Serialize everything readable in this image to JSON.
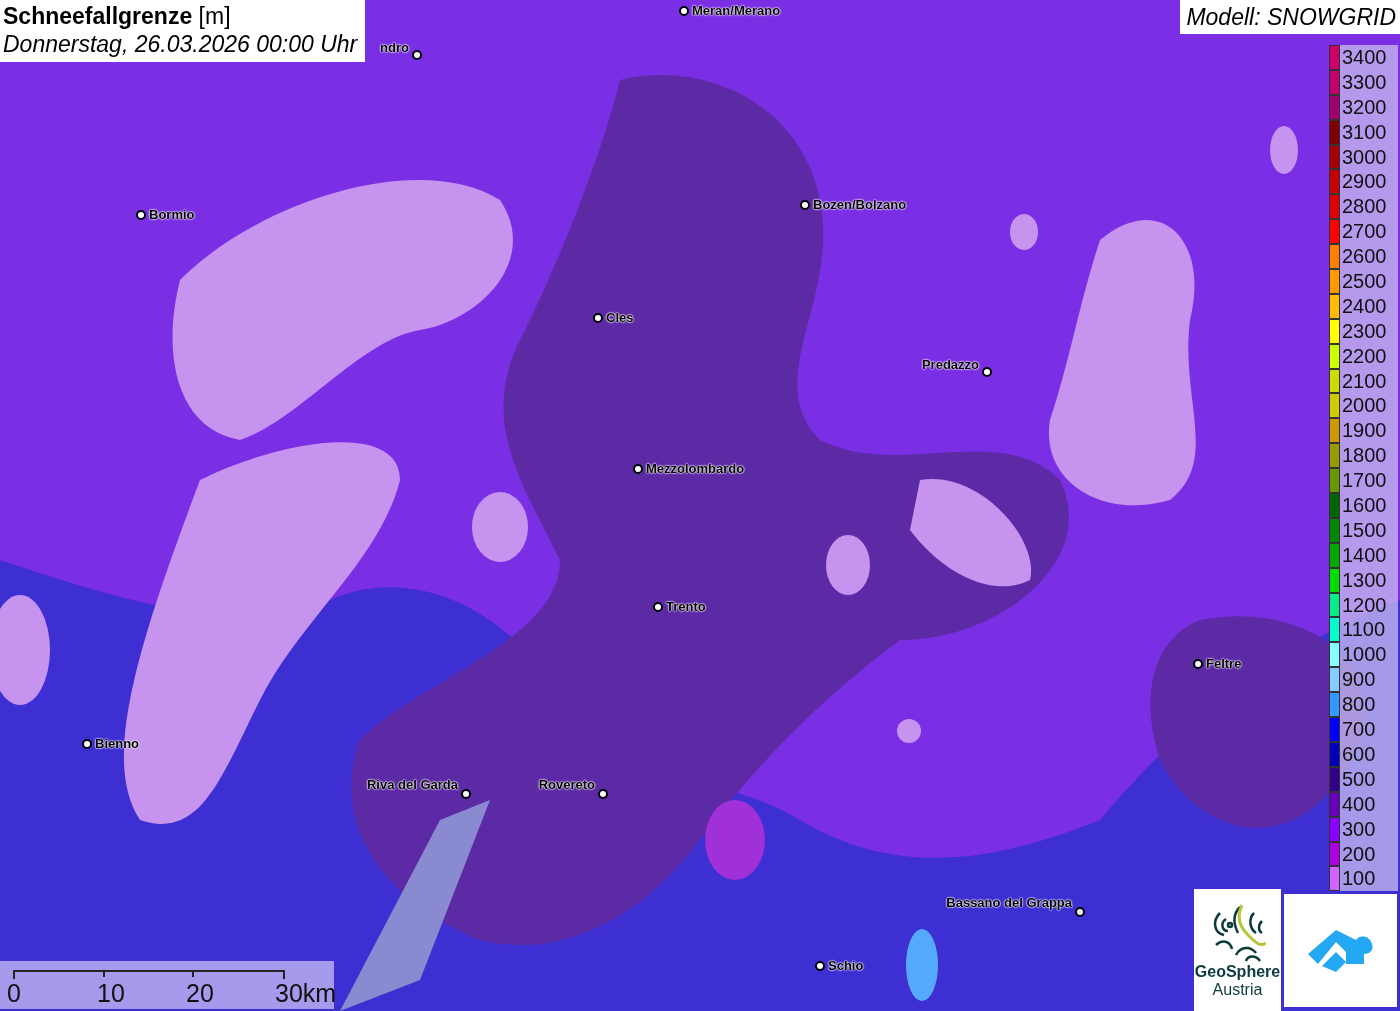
{
  "title": {
    "heading": "**Schneefallgrenze** [m]",
    "date": "Donnerstag, 26.03.2026 00:00 Uhr"
  },
  "model": "Modell: SNOWGRID",
  "places": [
    "Meran/Merano",
    "ndro",
    "Bormio",
    "Bozen/Bolzano",
    "Cles",
    "Predazzo",
    "Mezzolombardo",
    "Trento",
    "Feltre",
    "Bienno",
    "Riva del Garda",
    "Rovereto",
    "Bassano del Grappa",
    "Schio"
  ],
  "legend": [
    {
      "label": "3400",
      "color": "#cc0066"
    },
    {
      "label": "3300",
      "color": "#c2006b"
    },
    {
      "label": "3200",
      "color": "#a0006e"
    },
    {
      "label": "3100",
      "color": "#800000"
    },
    {
      "label": "3000",
      "color": "#a80000"
    },
    {
      "label": "2900",
      "color": "#c80000"
    },
    {
      "label": "2800",
      "color": "#e00000"
    },
    {
      "label": "2700",
      "color": "#ff0000"
    },
    {
      "label": "2600",
      "color": "#ff7f00"
    },
    {
      "label": "2500",
      "color": "#ff9900"
    },
    {
      "label": "2400",
      "color": "#ffbb00"
    },
    {
      "label": "2300",
      "color": "#ffff00"
    },
    {
      "label": "2200",
      "color": "#ccff00"
    },
    {
      "label": "2100",
      "color": "#ccdd00"
    },
    {
      "label": "2000",
      "color": "#cccc00"
    },
    {
      "label": "1900",
      "color": "#cc9900"
    },
    {
      "label": "1800",
      "color": "#999900"
    },
    {
      "label": "1700",
      "color": "#669900"
    },
    {
      "label": "1600",
      "color": "#006600"
    },
    {
      "label": "1500",
      "color": "#008800"
    },
    {
      "label": "1400",
      "color": "#00aa00"
    },
    {
      "label": "1300",
      "color": "#00dd00"
    },
    {
      "label": "1200",
      "color": "#00ee88"
    },
    {
      "label": "1100",
      "color": "#00ffcc"
    },
    {
      "label": "1000",
      "color": "#88ffff"
    },
    {
      "label": "900",
      "color": "#88ccff"
    },
    {
      "label": "800",
      "color": "#3399ff"
    },
    {
      "label": "700",
      "color": "#0000ff"
    },
    {
      "label": "600",
      "color": "#0000bb"
    },
    {
      "label": "500",
      "color": "#330088"
    },
    {
      "label": "400",
      "color": "#6600bb"
    },
    {
      "label": "300",
      "color": "#8800ff"
    },
    {
      "label": "200",
      "color": "#aa00dd"
    },
    {
      "label": "100",
      "color": "#cc66ff"
    }
  ],
  "scale": [
    "0",
    "10",
    "20",
    "30km"
  ],
  "logo": {
    "name": "GeoSphere",
    "sub": "Austria"
  }
}
